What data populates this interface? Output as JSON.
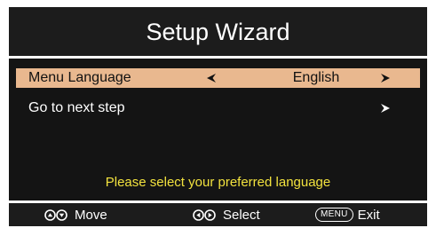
{
  "header": {
    "title": "Setup Wizard"
  },
  "menu": {
    "items": [
      {
        "label": "Menu Language",
        "value": "English",
        "selected": true
      },
      {
        "label": "Go to next step",
        "value": "",
        "selected": false
      }
    ],
    "hint": "Please select your preferred language"
  },
  "footer": {
    "move_label": "Move",
    "select_label": "Select",
    "menu_button_label": "MENU",
    "exit_label": "Exit"
  },
  "colors": {
    "background": "#1c1c1c",
    "selection_highlight": "#e9b88f",
    "hint_text": "#f2e23e",
    "text": "#ffffff"
  },
  "icons": [
    "left-arrow-icon",
    "right-arrow-icon",
    "up-down-buttons-icon",
    "left-right-buttons-icon",
    "menu-button-icon"
  ]
}
